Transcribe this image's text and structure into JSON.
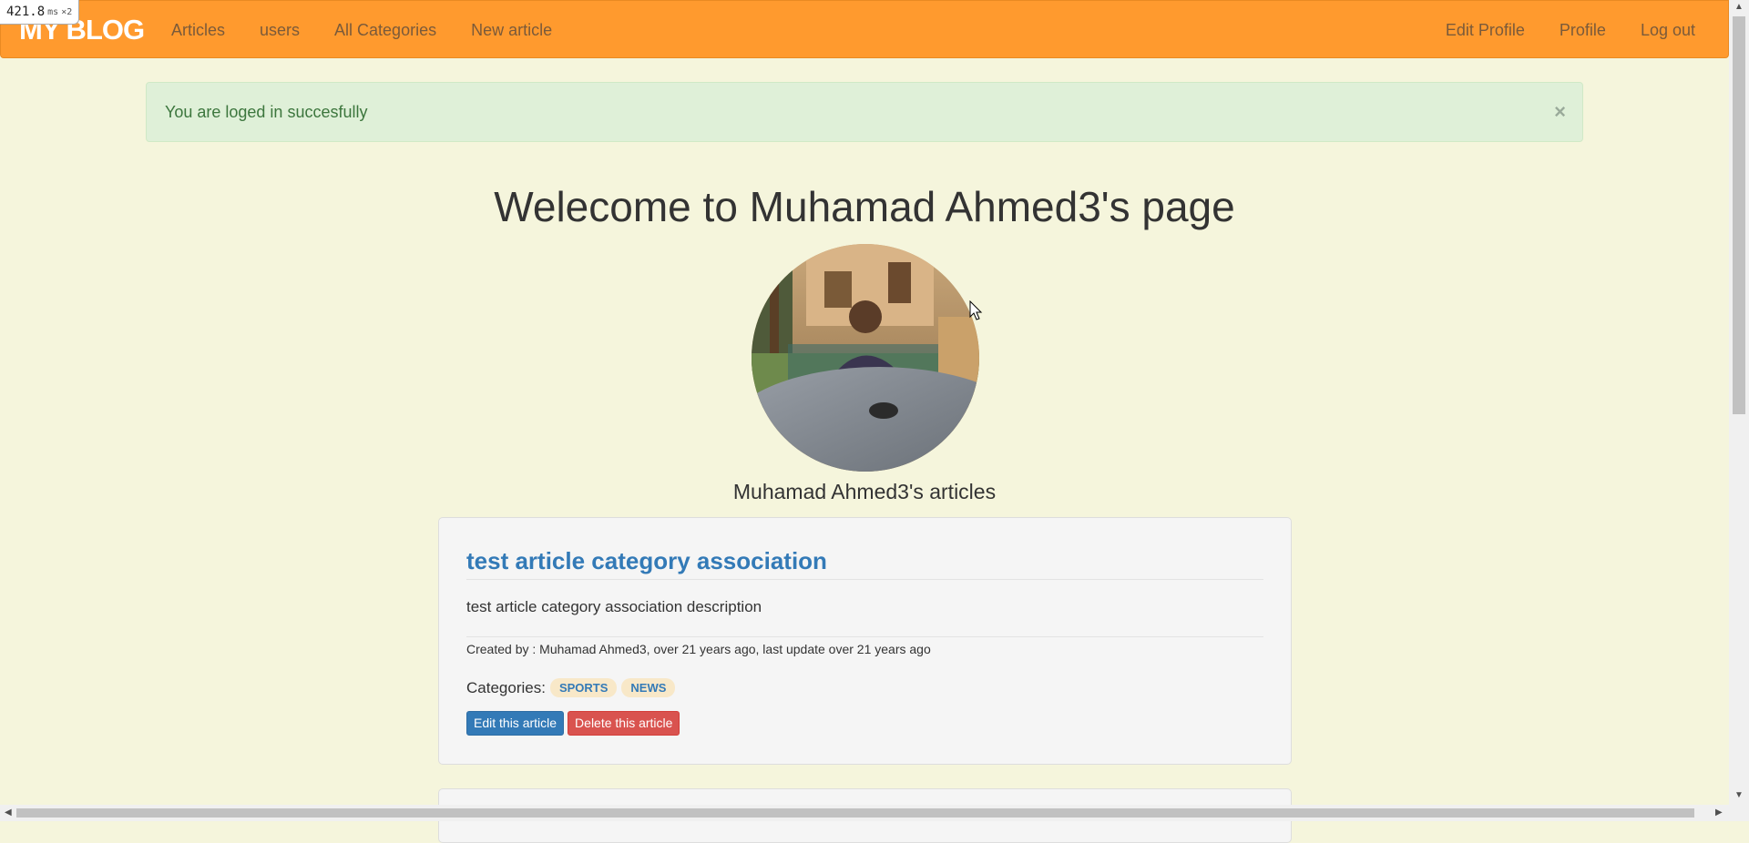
{
  "timer": {
    "value": "421.8",
    "unit": "ms",
    "multiplier": "×2"
  },
  "navbar": {
    "brand": "MY BLOG",
    "left_links": [
      "Articles",
      "users",
      "All Categories",
      "New article"
    ],
    "right_links": [
      "Edit Profile",
      "Profile",
      "Log out"
    ],
    "background": "#ff9a2e"
  },
  "alert": {
    "message": "You are loged in succesfully",
    "close": "×"
  },
  "page": {
    "title": "Welecome to Muhamad Ahmed3's page",
    "articles_heading": "Muhamad Ahmed3's articles"
  },
  "article": {
    "title": "test article category association",
    "description": "test article category association description",
    "meta": "Created by : Muhamad Ahmed3, over 21 years ago, last update over 21 years ago",
    "categories_label": "Categories:",
    "categories": [
      "SPORTS",
      "NEWS"
    ],
    "edit_label": "Edit this article",
    "delete_label": "Delete this article"
  },
  "colors": {
    "background": "#f5f5dc",
    "link": "#337ab7",
    "danger": "#d9534f",
    "alert_bg": "#dff0d8"
  }
}
